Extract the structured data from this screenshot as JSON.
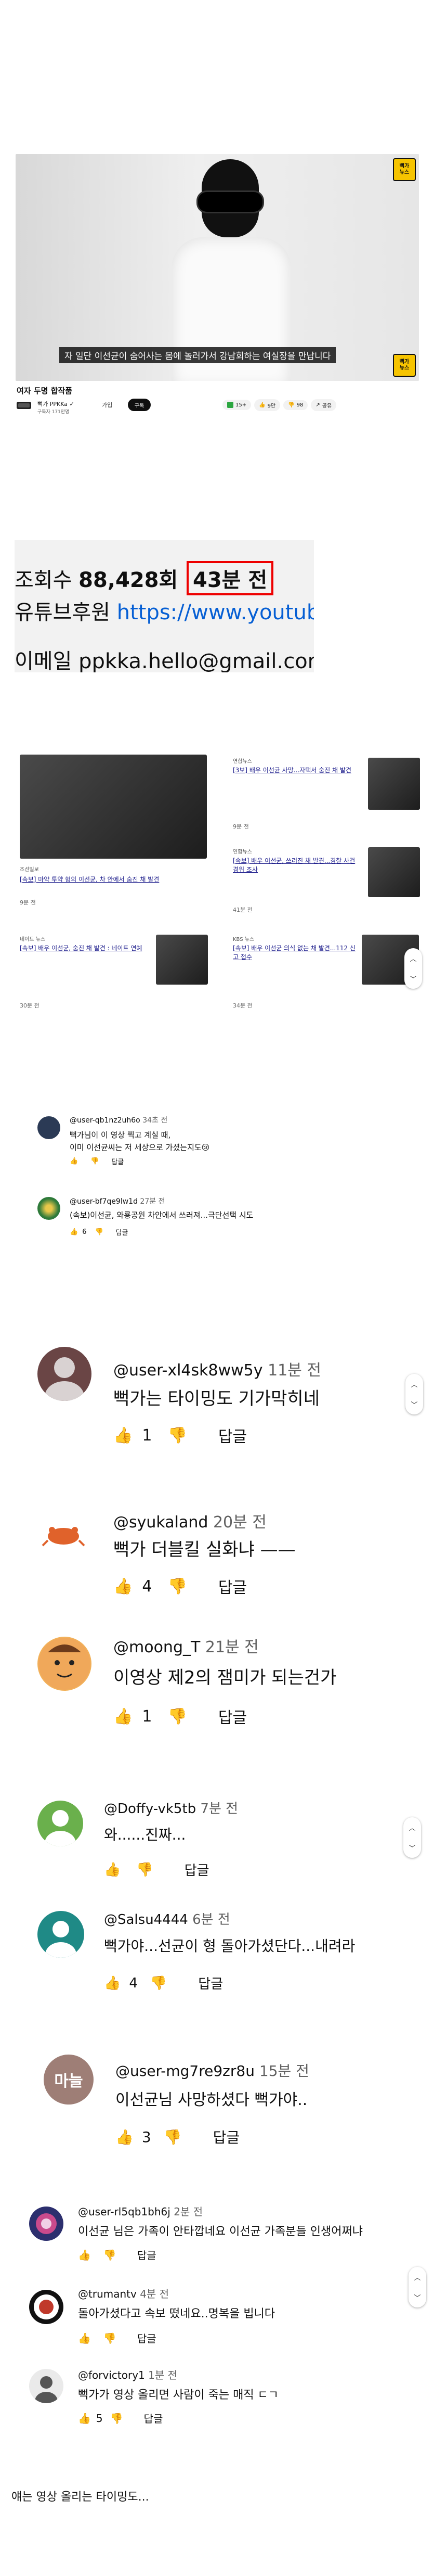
{
  "video": {
    "badge_top": "뻑가\n뉴스",
    "badge_bottom": "뻑가\n뉴스",
    "subtitle": "자 일단 이선균이 숨어사는 몸에 놀러가서 강남회하는 여실장을 만납니다",
    "title": "여자 두명 합작품",
    "channel_name": "뻑가 PPKKa ✓",
    "channel_subs": "구독자 171만명",
    "join_label": "가입",
    "subscribe_label": "구독",
    "actions": [
      {
        "label": "15+"
      },
      {
        "label": "9만"
      },
      {
        "label": "98"
      },
      {
        "label": "공유"
      }
    ]
  },
  "description": {
    "views_label": "조회수",
    "views_value": "88,428회",
    "time_ago": "43분 전",
    "support_label": "유튜브후원",
    "support_link": "https://www.youtube.co",
    "email_line": "이메일 ppkka.hello@gmail.com ...더보기"
  },
  "news": [
    {
      "source": "조선일보",
      "title": "[속보] 마약 투약 혐의 이선균, 차 안에서 숨진 채 발견",
      "time": "9분 전"
    },
    {
      "source": "연합뉴스",
      "title": "[3보] 배우 이선균 사망...자택서 숨진 채 발견",
      "time": "9분 전"
    },
    {
      "source": "연합뉴스",
      "title": "[속보] 배우 이선균, 쓰러진 채 발견...경찰 사건 경위 조사",
      "time": "41분 전"
    },
    {
      "source": "네이트 뉴스",
      "title": "[속보] 배우 이선균, 숨진 채 발견 : 네이트 연예",
      "time": "30분 전"
    },
    {
      "source": "KBS 뉴스",
      "title": "[속보] 배우 이선균 의식 없는 채 발견...112 신고 접수",
      "time": "34분 전"
    }
  ],
  "comments": [
    {
      "user": "@user-qb1nz2uh6o",
      "time": "34초 전",
      "lines": [
        "뻑가님이 이 영상 찍고 계실 때,",
        "이미 이선균씨는 저 세상으로 가셨는지도😢"
      ],
      "likes": "",
      "reply": "답글"
    },
    {
      "user": "@user-bf7qe9lw1d",
      "time": "27분 전",
      "lines": [
        "(속보)이선균, 와룡공원 차안에서 쓰러져...극단선택 시도"
      ],
      "likes": "6",
      "reply": "답글"
    },
    {
      "user": "@user-xl4sk8ww5y",
      "time": "11분 전",
      "lines": [
        "뻑가는 타이밍도 기가막히네"
      ],
      "likes": "1",
      "reply": "답글"
    },
    {
      "user": "@syukaland",
      "time": "20분 전",
      "lines": [
        "뻑가 더블킬 실화냐 ——"
      ],
      "likes": "4",
      "reply": "답글"
    },
    {
      "user": "@moong_T",
      "time": "21분 전",
      "lines": [
        "이영상 제2의 잼미가 되는건가"
      ],
      "likes": "1",
      "reply": "답글"
    },
    {
      "user": "@Doffy-vk5tb",
      "time": "7분 전",
      "lines": [
        "와......진짜..."
      ],
      "likes": "",
      "reply": "답글"
    },
    {
      "user": "@Salsu4444",
      "time": "6분 전",
      "lines": [
        "뻑가야...선균이 형 돌아가셨단다...내려라"
      ],
      "likes": "4",
      "reply": "답글"
    },
    {
      "user": "@user-mg7re9zr8u",
      "time": "15분 전",
      "lines": [
        "이선균님 사망하셨다 뻑가야.."
      ],
      "likes": "3",
      "reply": "답글",
      "avatar_text": "마늘"
    },
    {
      "user": "@user-rl5qb1bh6j",
      "time": "2분 전",
      "lines": [
        "이선균 님은 가족이 안타깝네요 이선균 가족분들 인생어쩌냐"
      ],
      "likes": "",
      "reply": "답글"
    },
    {
      "user": "@trumantv",
      "time": "4분 전",
      "lines": [
        "돌아가셨다고 속보 떴네요..명복을 빕니다"
      ],
      "likes": "",
      "reply": "답글"
    },
    {
      "user": "@forvictory1",
      "time": "1분 전",
      "lines": [
        "뻑가가 영상 올리면 사람이 죽는 매직 ㄷㄱ"
      ],
      "likes": "5",
      "reply": "답글"
    }
  ],
  "footer": "얘는 영상 올리는 타이밍도..."
}
